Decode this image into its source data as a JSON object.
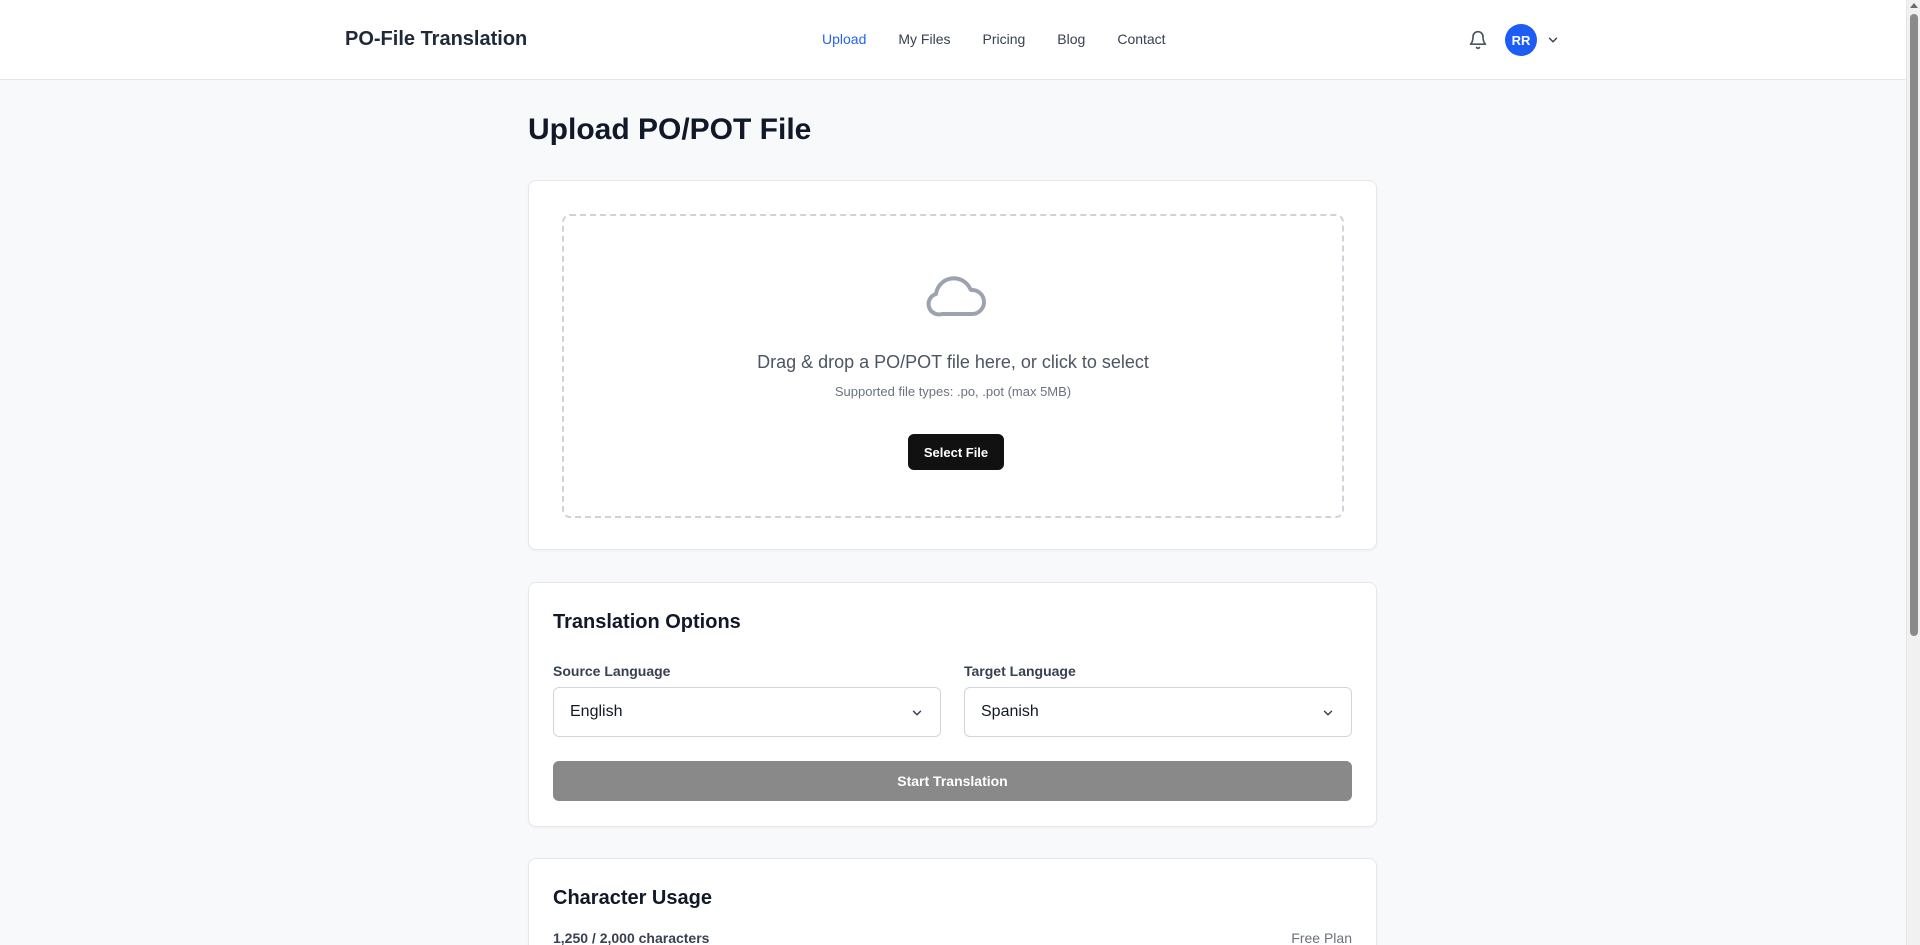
{
  "header": {
    "brand": "PO-File Translation",
    "nav": [
      {
        "label": "Upload",
        "active": true
      },
      {
        "label": "My Files",
        "active": false
      },
      {
        "label": "Pricing",
        "active": false
      },
      {
        "label": "Blog",
        "active": false
      },
      {
        "label": "Contact",
        "active": false
      }
    ],
    "notifications_icon": "bell-icon",
    "avatar_initials": "RR",
    "accent_color": "#2563eb"
  },
  "main": {
    "page_title": "Upload PO/POT File",
    "upload": {
      "icon": "cloud-icon",
      "drop_text": "Drag & drop a PO/POT file here, or click to select",
      "supported_text": "Supported file types: .po, .pot (max 5MB)",
      "select_button": "Select File"
    },
    "options": {
      "title": "Translation Options",
      "source_label": "Source Language",
      "source_value": "English",
      "target_label": "Target Language",
      "target_value": "Spanish",
      "start_button": "Start Translation"
    },
    "usage": {
      "title": "Character Usage",
      "count_text": "1,250 / 2,000 characters",
      "plan": "Free Plan"
    }
  }
}
